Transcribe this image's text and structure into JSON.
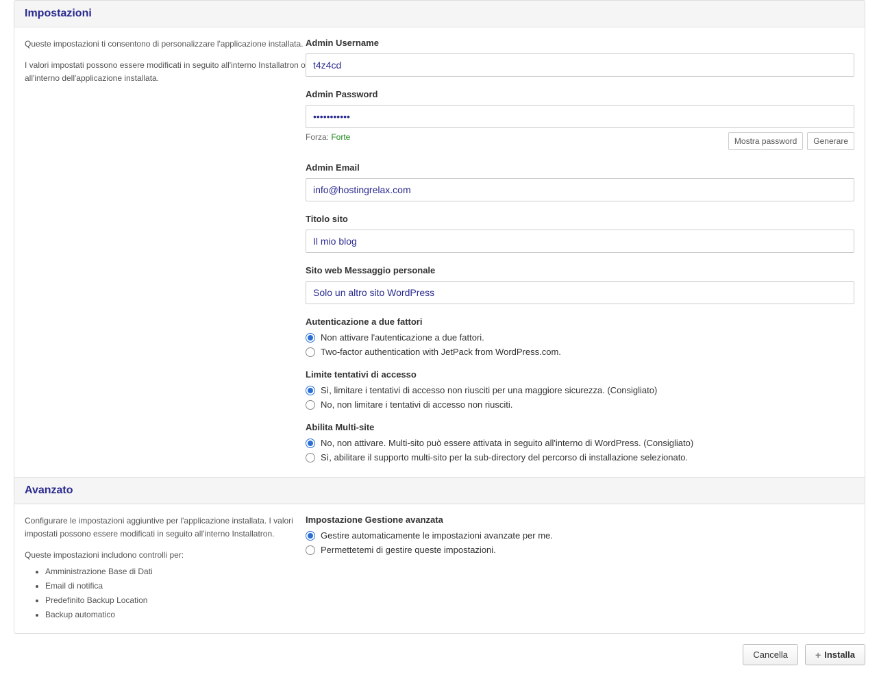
{
  "settings": {
    "title": "Impostazioni",
    "desc1": "Queste impostazioni ti consentono di personalizzare l'applicazione installata.",
    "desc2": "I valori impostati possono essere modificati in seguito all'interno Installatron o all'interno dell'applicazione installata.",
    "admin_username": {
      "label": "Admin Username",
      "value": "t4z4cd"
    },
    "admin_password": {
      "label": "Admin Password",
      "value": "•••••••••••"
    },
    "strength_label": "Forza: ",
    "strength_value": "Forte",
    "show_password": "Mostra password",
    "generate": "Generare",
    "admin_email": {
      "label": "Admin Email",
      "value": "info@hostingrelax.com"
    },
    "site_title": {
      "label": "Titolo sito",
      "value": "Il mio blog"
    },
    "site_message": {
      "label": "Sito web Messaggio personale",
      "value": "Solo un altro sito WordPress"
    },
    "two_factor": {
      "label": "Autenticazione a due fattori",
      "opt1": "Non attivare l'autenticazione a due fattori.",
      "opt2": "Two-factor authentication with JetPack from WordPress.com."
    },
    "login_limit": {
      "label": "Limite tentativi di accesso",
      "opt1": "Sì, limitare i tentativi di accesso non riusciti per una maggiore sicurezza. (Consigliato)",
      "opt2": "No, non limitare i tentativi di accesso non riusciti."
    },
    "multisite": {
      "label": "Abilita Multi-site",
      "opt1": "No, non attivare. Multi-sito può essere attivata in seguito all'interno di WordPress. (Consigliato)",
      "opt2": "Sì, abilitare il supporto multi-sito per la sub-directory del percorso di installazione selezionato."
    }
  },
  "advanced": {
    "title": "Avanzato",
    "desc1": "Configurare le impostazioni aggiuntive per l'applicazione installata. I valori impostati possono essere modificati in seguito all'interno Installatron.",
    "desc2": "Queste impostazioni includono controlli per:",
    "bullets": {
      "b1": "Amministrazione Base di Dati",
      "b2": "Email di notifica",
      "b3": "Predefinito Backup Location",
      "b4": "Backup automatico"
    },
    "mgmt": {
      "label": "Impostazione Gestione avanzata",
      "opt1": "Gestire automaticamente le impostazioni avanzate per me.",
      "opt2": "Permettetemi di gestire queste impostazioni."
    }
  },
  "footer": {
    "cancel": "Cancella",
    "install": "Installa"
  }
}
